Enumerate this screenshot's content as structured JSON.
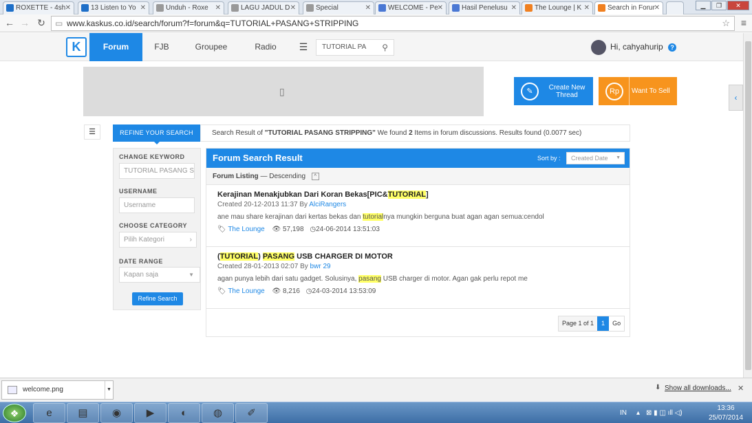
{
  "browser": {
    "tabs": [
      {
        "label": "ROXETTE - 4sh",
        "icon": "4shared-icon",
        "color": "#1e6fc8"
      },
      {
        "label": "13 Listen to Yo",
        "icon": "4shared-icon",
        "color": "#1e6fc8"
      },
      {
        "label": "Unduh - Roxe",
        "icon": "document-icon",
        "color": "#888888"
      },
      {
        "label": "LAGU JADUL D",
        "icon": "document-icon",
        "color": "#888888"
      },
      {
        "label": "Special",
        "icon": "document-icon",
        "color": "#888888"
      },
      {
        "label": "WELCOME - Pe",
        "icon": "google-icon",
        "color": "#4a78d4"
      },
      {
        "label": "Hasil Penelusu",
        "icon": "google-icon",
        "color": "#4a78d4"
      },
      {
        "label": "The Lounge | K",
        "icon": "kaskus-icon",
        "color": "#f08020"
      },
      {
        "label": "Search in Forur",
        "icon": "kaskus-icon",
        "color": "#f08020"
      }
    ],
    "url": "www.kaskus.co.id/search/forum?f=forum&q=TUTORIAL+PASANG+STRIPPING"
  },
  "header": {
    "nav": [
      "Forum",
      "FJB",
      "Groupee",
      "Radio"
    ],
    "search_value": "TUTORIAL PA",
    "greeting": "Hi, cahyahurip",
    "help": "?"
  },
  "actions": {
    "create_thread": "Create New Thread",
    "want_to_sell": "Want To Sell",
    "create_color": "#1e88e5",
    "sell_color": "#f7941d"
  },
  "refine": {
    "tab_label": "REFINE YOUR SEARCH",
    "change_keyword_label": "CHANGE KEYWORD",
    "keyword_value": "TUTORIAL PASANG S",
    "username_label": "USERNAME",
    "username_placeholder": "Username",
    "category_label": "CHOOSE CATEGORY",
    "category_value": "Pilih Kategori",
    "date_label": "DATE RANGE",
    "date_value": "Kapan saja",
    "button": "Refine Search"
  },
  "summary": {
    "prefix": "Search Result of ",
    "query": "\"TUTORIAL PASANG STRIPPING\"",
    "middle": " We found ",
    "count": "2",
    "suffix": " Items in forum discussions. Results found (0.0077 sec)"
  },
  "results": {
    "title": "Forum Search Result",
    "sort_label": "Sort by :",
    "sort_value": "Created Date",
    "listing": "Forum Listing",
    "order": "— Descending",
    "items": [
      {
        "title_before": "Kerajinan Menakjubkan Dari Koran Bekas[PIC&",
        "title_hl": "TUTORIAL",
        "title_after": "]",
        "created": "Created 20-12-2013 11:37 By",
        "author": "AlciRangers",
        "excerpt_before": "ane mau share kerajinan dari kertas bekas dan",
        "excerpt_hl": "tutorial",
        "excerpt_after": "nya mungkin berguna buat agan agan semua:cendol",
        "forum": "The Lounge",
        "views": "57,198",
        "last": "24-06-2014 13:51:03"
      },
      {
        "title_pre": "(",
        "title_hl1": "TUTORIAL",
        "title_mid": ")",
        "title_hl2": "PASANG",
        "title_after": "USB CHARGER DI MOTOR",
        "created": "Created 28-01-2013 02:07 By",
        "author": "bwr 29",
        "excerpt_before": "agan punya lebih dari satu gadget. Solusinya,",
        "excerpt_hl": "pasang",
        "excerpt_after": "USB charger di motor. Agan gak perlu repot me",
        "forum": "The Lounge",
        "views": "8,216",
        "last": "24-03-2014 13:53:09"
      }
    ],
    "pager": {
      "label": "Page 1 of 1",
      "current": "1",
      "go": "Go"
    }
  },
  "downloads": {
    "file": "welcome.png",
    "show_all": "Show all downloads..."
  },
  "taskbar": {
    "lang": "IN",
    "time": "13:36",
    "date": "25/07/2014"
  }
}
